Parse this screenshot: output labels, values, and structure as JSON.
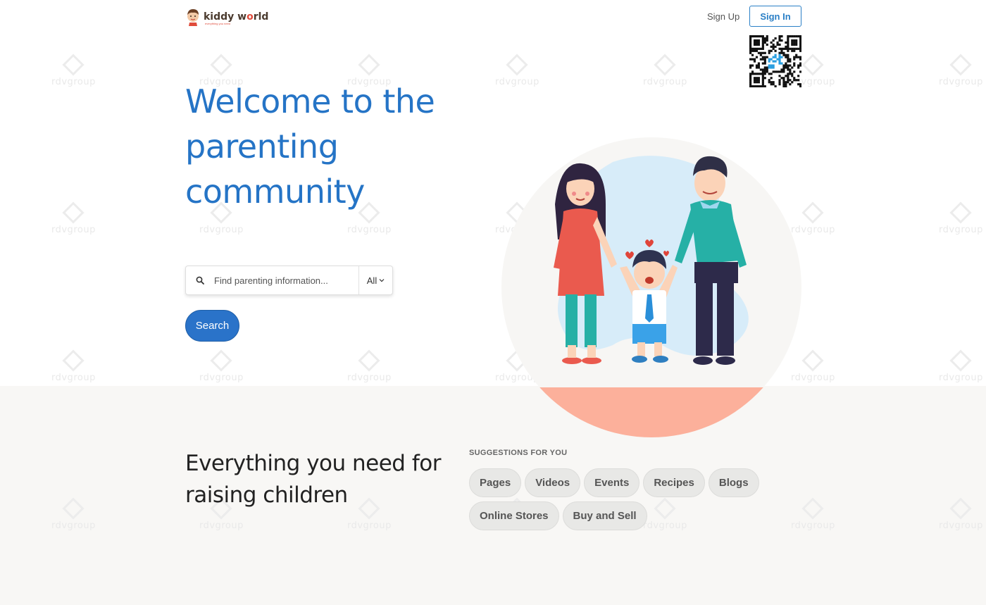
{
  "header": {
    "logo_text_start": "kiddy w",
    "logo_text_o": "o",
    "logo_text_end": "rld",
    "logo_tagline": "everything you need",
    "sign_up_label": "Sign Up",
    "sign_in_label": "Sign In"
  },
  "hero": {
    "title_line1": "Welcome to the",
    "title_line2": "parenting",
    "title_line3": "community",
    "search": {
      "placeholder": "Find parenting information...",
      "value": "",
      "scope_label": "All",
      "search_icon": "search-icon",
      "scope_icon": "chevron-down-icon"
    },
    "search_button_label": "Search"
  },
  "watermark_text": "rdvgroup",
  "features": {
    "title_line1": "Everything you need for",
    "title_line2": "raising children",
    "suggestions_label": "SUGGESTIONS FOR YOU",
    "chips": [
      "Pages",
      "Videos",
      "Events",
      "Recipes",
      "Blogs",
      "Online Stores",
      "Buy and Sell"
    ]
  },
  "colors": {
    "accent": "#2574c6",
    "button": "#2a73c9",
    "chip_bg": "#e8e8e6",
    "illustration_circle": "#f7f6f4",
    "illustration_arc": "#fcb09b"
  }
}
